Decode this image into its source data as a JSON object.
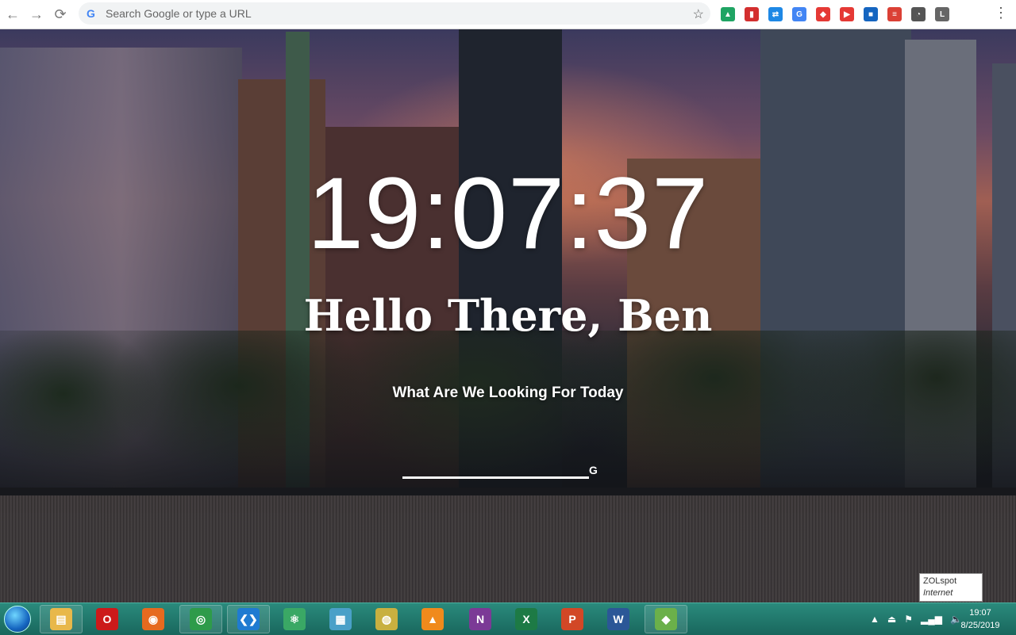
{
  "browser": {
    "omnibox_placeholder": "Search Google or type a URL",
    "omnibox_g": "G",
    "extensions": [
      {
        "name": "google-drive-icon",
        "color": "#1fa463",
        "glyph": "▲"
      },
      {
        "name": "bookmark-red-icon",
        "color": "#d32f2f",
        "glyph": "▮"
      },
      {
        "name": "sync-icon",
        "color": "#1e88e5",
        "glyph": "⇄"
      },
      {
        "name": "translate-icon",
        "color": "#4285f4",
        "glyph": "G"
      },
      {
        "name": "shield-icon",
        "color": "#e53935",
        "glyph": "◆"
      },
      {
        "name": "pdf-icon",
        "color": "#e53935",
        "glyph": "▶"
      },
      {
        "name": "square-blue-icon",
        "color": "#1565c0",
        "glyph": "■"
      },
      {
        "name": "todoist-icon",
        "color": "#db4035",
        "glyph": "≡"
      },
      {
        "name": "speedometer-icon",
        "color": "#555555",
        "glyph": "◔"
      },
      {
        "name": "letter-l-icon",
        "color": "#666666",
        "glyph": "L"
      }
    ]
  },
  "page": {
    "time": "19:07:37",
    "greeting": "Hello There, Ben",
    "prompt": "What Are We Looking For Today",
    "search_g": "G"
  },
  "tooltip": {
    "title": "ZOLspot",
    "subtitle": "Internet access"
  },
  "taskbar": {
    "apps": [
      {
        "name": "file-explorer-icon",
        "color": "#e8b84a",
        "glyph": "▤",
        "pinned": true
      },
      {
        "name": "opera-icon",
        "color": "#cc1a1a",
        "glyph": "O",
        "pinned": false
      },
      {
        "name": "firefox-icon",
        "color": "#e66a1f",
        "glyph": "◉",
        "pinned": false
      },
      {
        "name": "chrome-icon",
        "color": "#2e9b4a",
        "glyph": "◎",
        "pinned": true
      },
      {
        "name": "vscode-icon",
        "color": "#1f7bd1",
        "glyph": "❮❯",
        "pinned": true
      },
      {
        "name": "atom-icon",
        "color": "#3aa865",
        "glyph": "⚛",
        "pinned": false
      },
      {
        "name": "maze-app-icon",
        "color": "#4aa0c8",
        "glyph": "▦",
        "pinned": false
      },
      {
        "name": "dvd-icon",
        "color": "#c8b040",
        "glyph": "◍",
        "pinned": false
      },
      {
        "name": "vlc-icon",
        "color": "#f08a1c",
        "glyph": "▲",
        "pinned": false
      },
      {
        "name": "onenote-icon",
        "color": "#7b3a96",
        "glyph": "N",
        "pinned": false
      },
      {
        "name": "excel-icon",
        "color": "#1d7a45",
        "glyph": "X",
        "pinned": false
      },
      {
        "name": "powerpoint-icon",
        "color": "#d24726",
        "glyph": "P",
        "pinned": false
      },
      {
        "name": "word-icon",
        "color": "#2b5797",
        "glyph": "W",
        "pinned": false
      },
      {
        "name": "maps-app-icon",
        "color": "#6bb04a",
        "glyph": "◆",
        "pinned": true
      }
    ],
    "tray_time": "19:07",
    "tray_date": "8/25/2019"
  }
}
